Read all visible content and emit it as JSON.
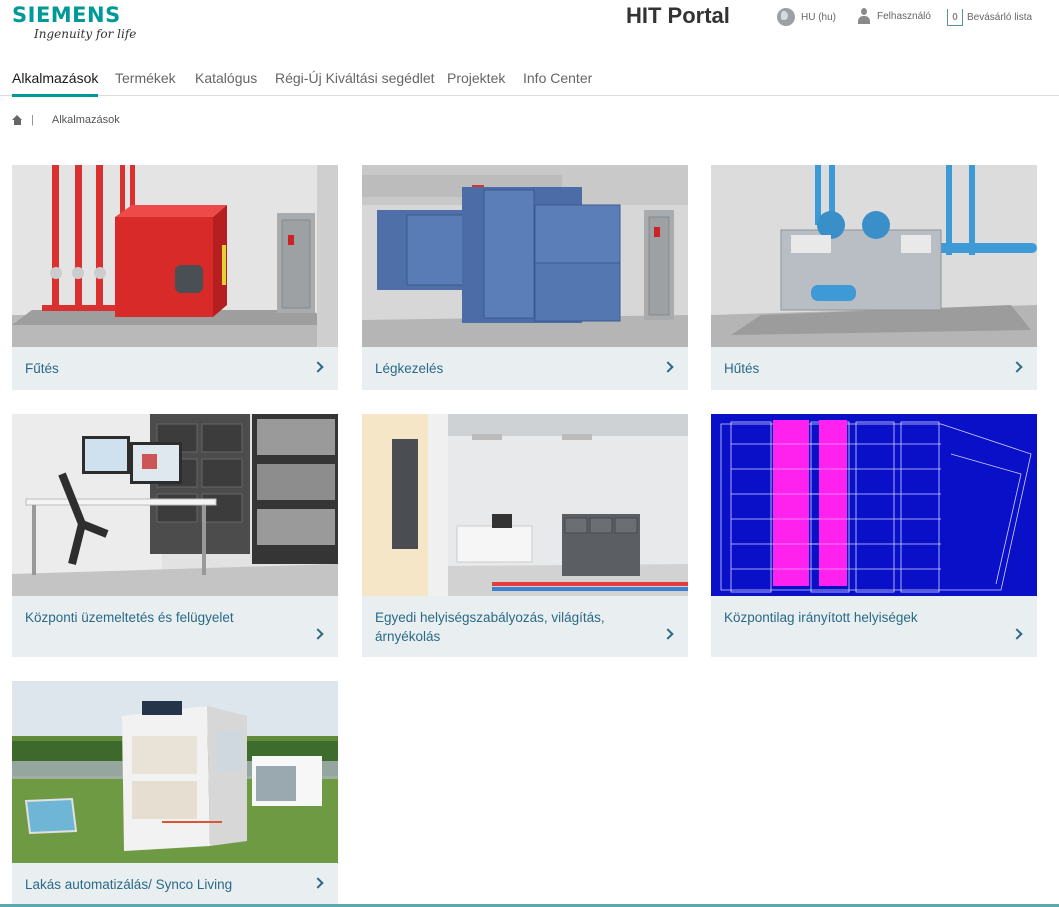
{
  "brand": {
    "name": "SIEMENS",
    "tagline": "Ingenuity for life"
  },
  "header": {
    "title": "HIT Portal",
    "language": "HU (hu)",
    "user": "Felhasználó",
    "cart_count": "0",
    "cart_label": "Bevásárló lista"
  },
  "nav": {
    "items": [
      {
        "label": "Alkalmazások",
        "active": true
      },
      {
        "label": "Termékek"
      },
      {
        "label": "Katalógus"
      },
      {
        "label": "Régi-Új Kiváltási segédlet"
      },
      {
        "label": "Projektek"
      },
      {
        "label": "Info Center"
      }
    ]
  },
  "breadcrumb": {
    "current": "Alkalmazások"
  },
  "cards": [
    {
      "label": "Fűtés",
      "icon": "chevron-right-icon"
    },
    {
      "label": "Légkezelés",
      "icon": "chevron-right-icon"
    },
    {
      "label": "Hűtés",
      "icon": "chevron-right-icon"
    },
    {
      "label": "Központi üzemeltetés és felügyelet",
      "icon": "chevron-right-icon"
    },
    {
      "label": "Egyedi helyiségszabályozás, világítás, árnyékolás",
      "icon": "chevron-right-icon"
    },
    {
      "label": "Központilag irányított helyiségek",
      "icon": "chevron-right-icon"
    },
    {
      "label": "Lakás automatizálás/ Synco Living",
      "icon": "chevron-right-icon"
    }
  ],
  "colors": {
    "accent": "#009999",
    "link": "#2a6a86",
    "card_bg": "#e9eef1"
  }
}
